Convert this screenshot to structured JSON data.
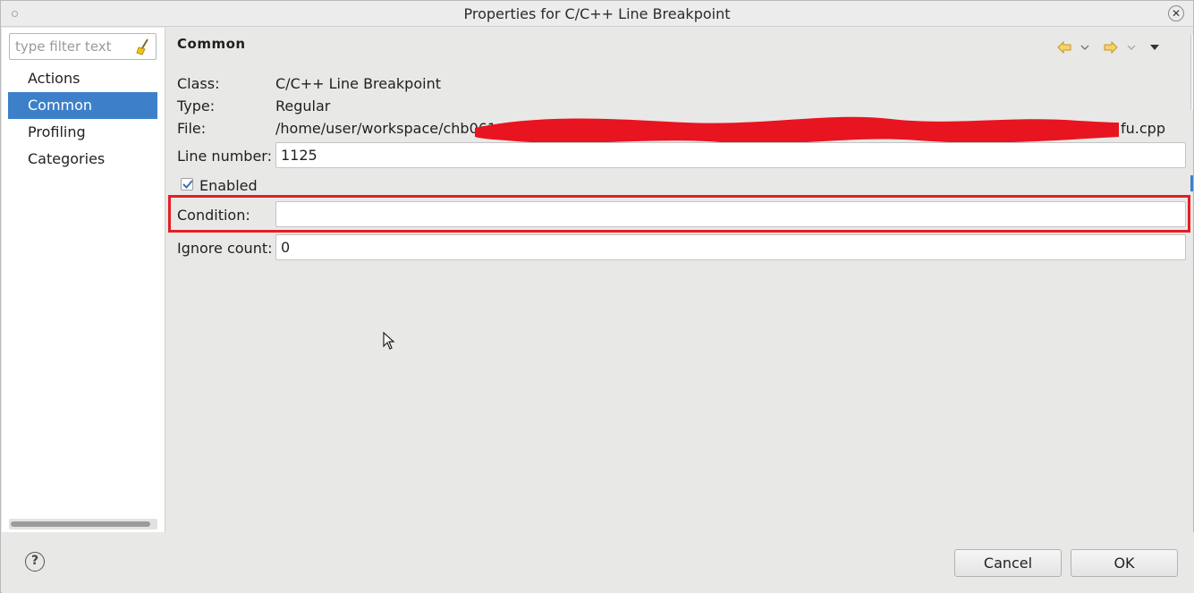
{
  "window": {
    "title": "Properties for C/C++ Line Breakpoint"
  },
  "sidebar": {
    "filter_placeholder": "type filter text",
    "items": [
      {
        "label": "Actions",
        "selected": false
      },
      {
        "label": "Common",
        "selected": true
      },
      {
        "label": "Profiling Categories",
        "selected": false
      }
    ]
  },
  "main": {
    "section_title": "Common",
    "class_label": "Class:",
    "class_value": "C/C++ Line Breakpoint",
    "type_label": "Type:",
    "type_value": "Regular",
    "file_label": "File:",
    "file_value_start": "/home/user/workspace/chb061",
    "file_value_end": "fu.cpp",
    "line_number_label": "Line number:",
    "line_number_value": "1125",
    "enabled_label": "Enabled",
    "enabled_checked": true,
    "condition_label": "Condition:",
    "condition_value": "",
    "ignore_count_label": "Ignore count:",
    "ignore_count_value": "0"
  },
  "footer": {
    "cancel_label": "Cancel",
    "ok_label": "OK"
  },
  "colors": {
    "selection": "#3d80c9",
    "highlight_box": "#e41e25",
    "redaction": "#e8141f",
    "nav_arrow": "#d9a520"
  }
}
